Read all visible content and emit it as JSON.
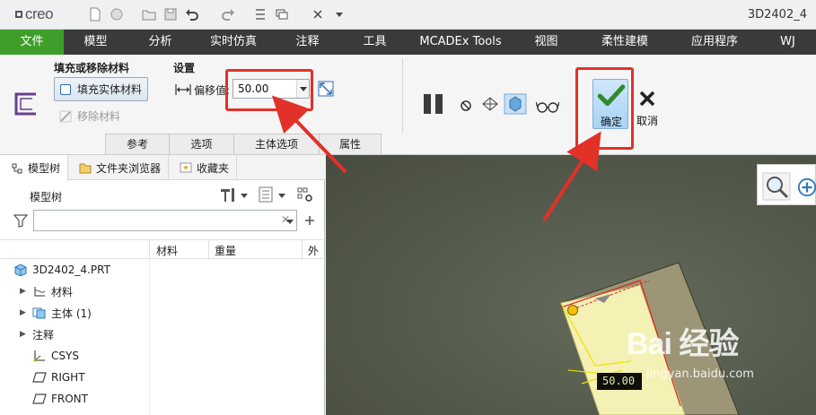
{
  "app": {
    "logo_text": "creo",
    "title": "3D2402_4"
  },
  "menu": {
    "tabs": [
      "文件",
      "模型",
      "分析",
      "实时仿真",
      "注释",
      "工具",
      "MCADEx Tools",
      "视图",
      "柔性建模",
      "应用程序",
      "WJ"
    ]
  },
  "ribbon": {
    "group_fill": {
      "title": "填充或移除材料",
      "fill_label": "填充实体材料",
      "remove_label": "移除材料"
    },
    "group_settings": {
      "title": "设置",
      "offset_label": "偏移值:",
      "offset_value": "50.00"
    },
    "bottom_tabs": [
      "参考",
      "选项",
      "主体选项",
      "属性"
    ],
    "ok_label": "确定",
    "cancel_label": "取消"
  },
  "left_panel": {
    "tabs": [
      "模型树",
      "文件夹浏览器",
      "收藏夹"
    ],
    "tree_title": "模型树",
    "filter_placeholder": "",
    "columns": [
      "材料",
      "重量",
      "外"
    ],
    "tree": [
      {
        "label": "3D2402_4.PRT",
        "expandable": false,
        "icon": "part-icon"
      },
      {
        "label": "材料",
        "expandable": true,
        "icon": "material-icon"
      },
      {
        "label": "主体 (1)",
        "expandable": true,
        "icon": "body-icon"
      },
      {
        "label": "注释",
        "expandable": true,
        "icon": "none"
      },
      {
        "label": "CSYS",
        "expandable": false,
        "icon": "csys-icon"
      },
      {
        "label": "RIGHT",
        "expandable": false,
        "icon": "datum-plane-icon"
      },
      {
        "label": "FRONT",
        "expandable": false,
        "icon": "datum-plane-icon"
      }
    ]
  },
  "viewport": {
    "dimension_label": "50.00",
    "watermark_main": "Bai 经验",
    "watermark_sub": "jingyan.baidu.com"
  },
  "colors": {
    "menu_active": "#3f9e2a",
    "menu_bg": "#3a3a3a",
    "annotation_red": "#e23128"
  }
}
